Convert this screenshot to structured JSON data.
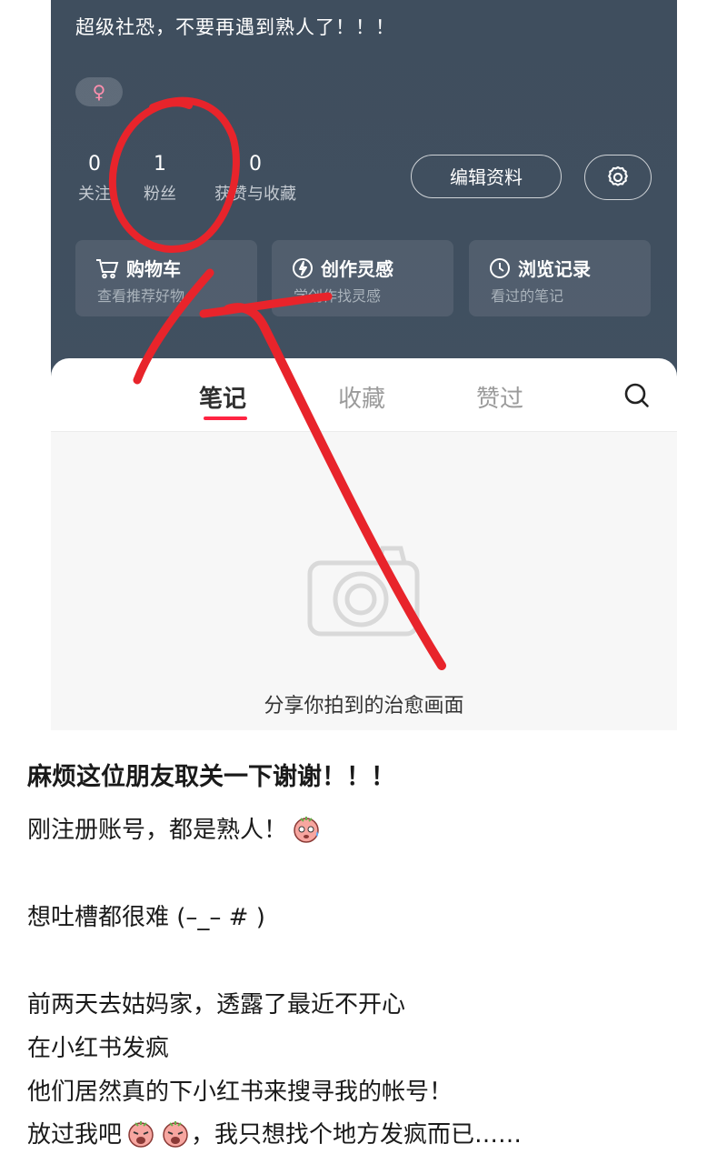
{
  "profile": {
    "bio": "超级社恐，不要再遇到熟人了！！！",
    "gender_icon": "♀",
    "stats": [
      {
        "value": "0",
        "label": "关注"
      },
      {
        "value": "1",
        "label": "粉丝"
      },
      {
        "value": "0",
        "label": "获赞与收藏"
      }
    ],
    "edit_button": "编辑资料",
    "settings_icon": "gear-icon",
    "cards": [
      {
        "title": "购物车",
        "subtitle": "查看推荐好物",
        "icon": "cart-icon"
      },
      {
        "title": "创作灵感",
        "subtitle": "学创作找灵感",
        "icon": "bulb-icon"
      },
      {
        "title": "浏览记录",
        "subtitle": "看过的笔记",
        "icon": "clock-icon"
      }
    ]
  },
  "tabs": [
    {
      "label": "笔记",
      "active": true
    },
    {
      "label": "收藏",
      "active": false
    },
    {
      "label": "赞过",
      "active": false
    }
  ],
  "search_icon": "search-icon",
  "empty_state": {
    "icon": "camera-icon",
    "text": "分享你拍到的治愈画面"
  },
  "post": {
    "title": "麻烦这位朋友取关一下谢谢！！！",
    "lines": [
      "刚注册账号，都是熟人！",
      "想吐槽都很难 (–_– # )",
      "前两天去姑妈家，透露了最近不开心",
      "在小红书发疯",
      "他们居然真的下小红书来搜寻我的帐号！",
      "放过我吧",
      "，我只想找个地方发疯而已……"
    ]
  },
  "colors": {
    "header_bg": "#404f5f",
    "accent_red": "#ff2442",
    "annotation_red": "#e8242b"
  }
}
